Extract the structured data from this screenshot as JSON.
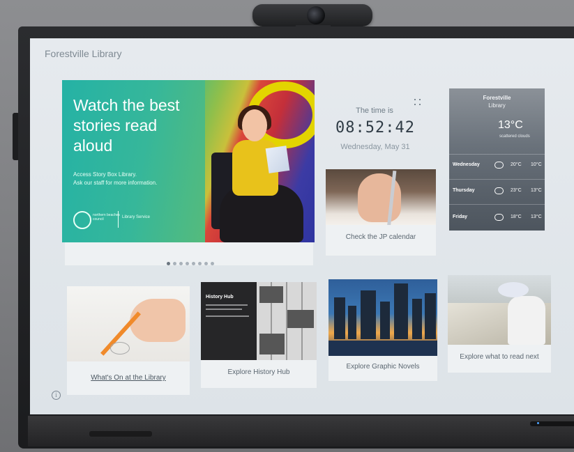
{
  "library": {
    "title": "Forestville Library"
  },
  "hero": {
    "headline": "Watch the best stories read aloud",
    "sub1": "Access Story Box Library.",
    "sub2": "Ask our staff for more information.",
    "logo_text": "northern beaches council",
    "logo_service": "Library Service",
    "slide_count": 8,
    "active_slide": 1
  },
  "clock": {
    "label": "The time is",
    "time": "08:52:42",
    "date": "Wednesday, May 31"
  },
  "weather": {
    "place_line1": "Forestville",
    "place_line2": "Library",
    "temp": "13°C",
    "desc": "scattered clouds",
    "forecast": [
      {
        "day": "Wednesday",
        "icon": "cloud-icon",
        "hi": "20°C",
        "lo": "10°C"
      },
      {
        "day": "Thursday",
        "icon": "cloud-icon",
        "hi": "23°C",
        "lo": "13°C"
      },
      {
        "day": "Friday",
        "icon": "cloud-icon",
        "hi": "18°C",
        "lo": "13°C"
      }
    ]
  },
  "tiles": {
    "jp": "Check the JP calendar",
    "whats_on": "What's On at the Library",
    "history_hub": "Explore History Hub",
    "history_hub_title": "History Hub",
    "graphic_novels": "Explore Graphic Novels",
    "what_to_read": "Explore what to read next"
  },
  "info_icon": "i"
}
